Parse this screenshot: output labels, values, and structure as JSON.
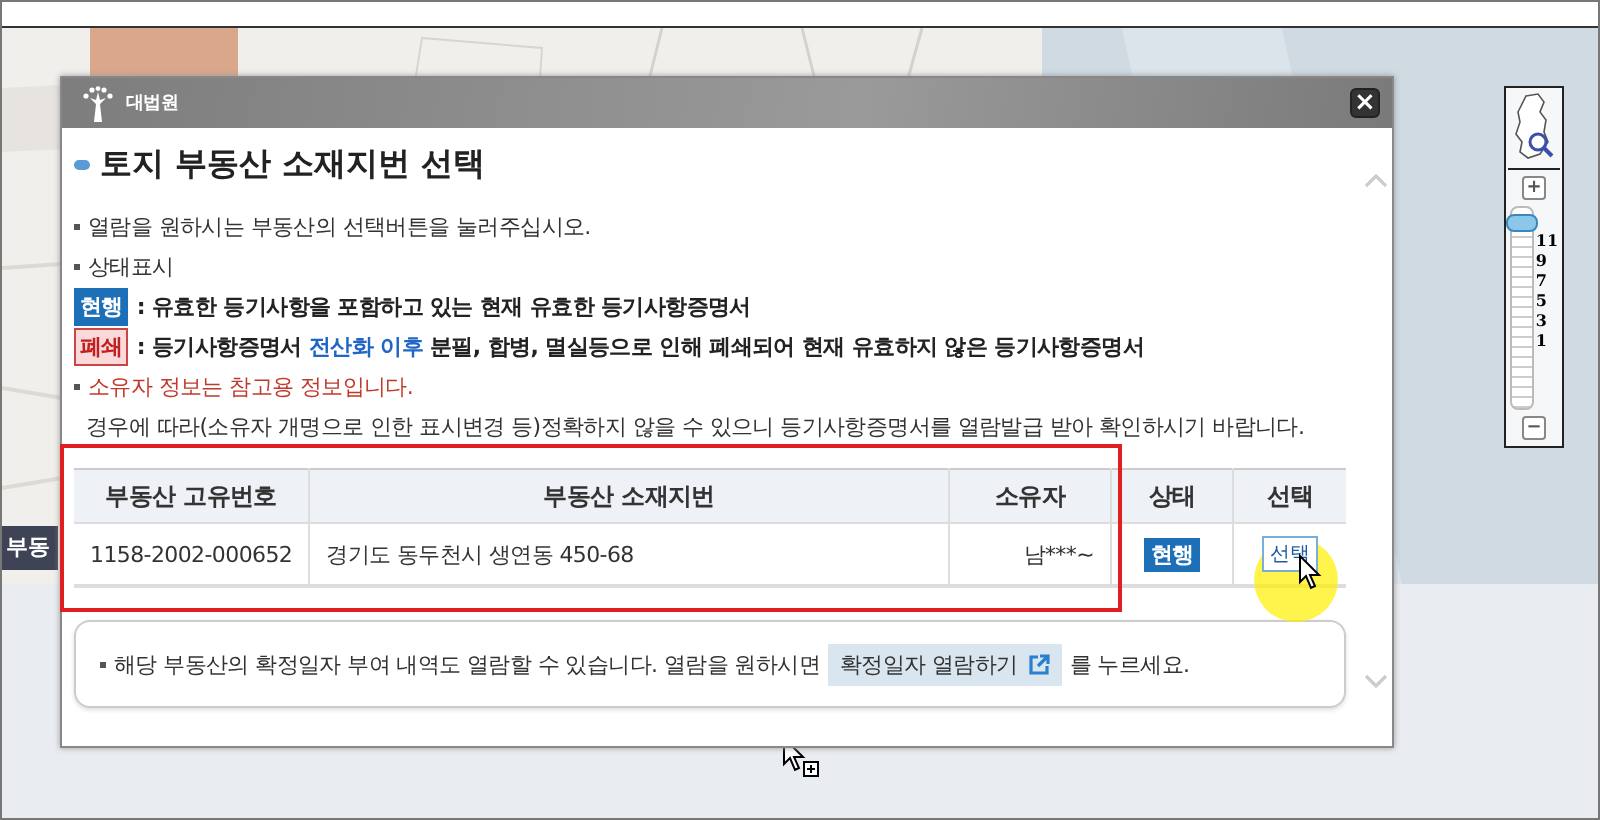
{
  "side_tab": {
    "label": "부동"
  },
  "zoom_control": {
    "zoom_in": "+",
    "zoom_out": "−",
    "labels": [
      "11",
      "9",
      "7",
      "5",
      "3",
      "1"
    ],
    "level": 0.97
  },
  "dialog": {
    "brand": "대법원",
    "close": "×",
    "title": "토지 부동산 소재지번 선택",
    "intro": "열람을 원하시는 부동산의 선택버튼을 눌러주십시오.",
    "legend_title": "상태표시",
    "legend": [
      {
        "kind": "current",
        "badge": "현행",
        "text": ": 유효한 등기사항을 포함하고 있는 현재 유효한 등기사항증명서"
      },
      {
        "kind": "closed",
        "badge": "폐쇄",
        "text": ": 등기사항증명서 **전산화 이후** 분필, 합병, 멸실등으로 인해 폐쇄되어 현재 유효하지 않은 등기사항증명서"
      }
    ],
    "warning": "소유자 정보는 참고용 정보입니다.",
    "warning_detail": "경우에 따라(소유자 개명으로 인한 표시변경 등)정확하지 않을 수 있으니 등기사항증명서를 열람발급 받아 확인하시기 바랍니다.",
    "table": {
      "columns": [
        "부동산 고유번호",
        "부동산 소재지번",
        "소유자",
        "상태",
        "선택"
      ],
      "rows": [
        {
          "number": "1158-2002-000652",
          "address": "경기도 동두천시 생연동 450-68",
          "owner": "남***~",
          "status": {
            "kind": "current",
            "label": "현행"
          },
          "select": "선택"
        }
      ]
    },
    "footer": {
      "text": "해당 부동산의 확정일자 부여 내역도 열람할 수 있습니다. 열람을 원하시면",
      "button": "확정일자 열람하기",
      "after": "를 누르세요."
    }
  }
}
